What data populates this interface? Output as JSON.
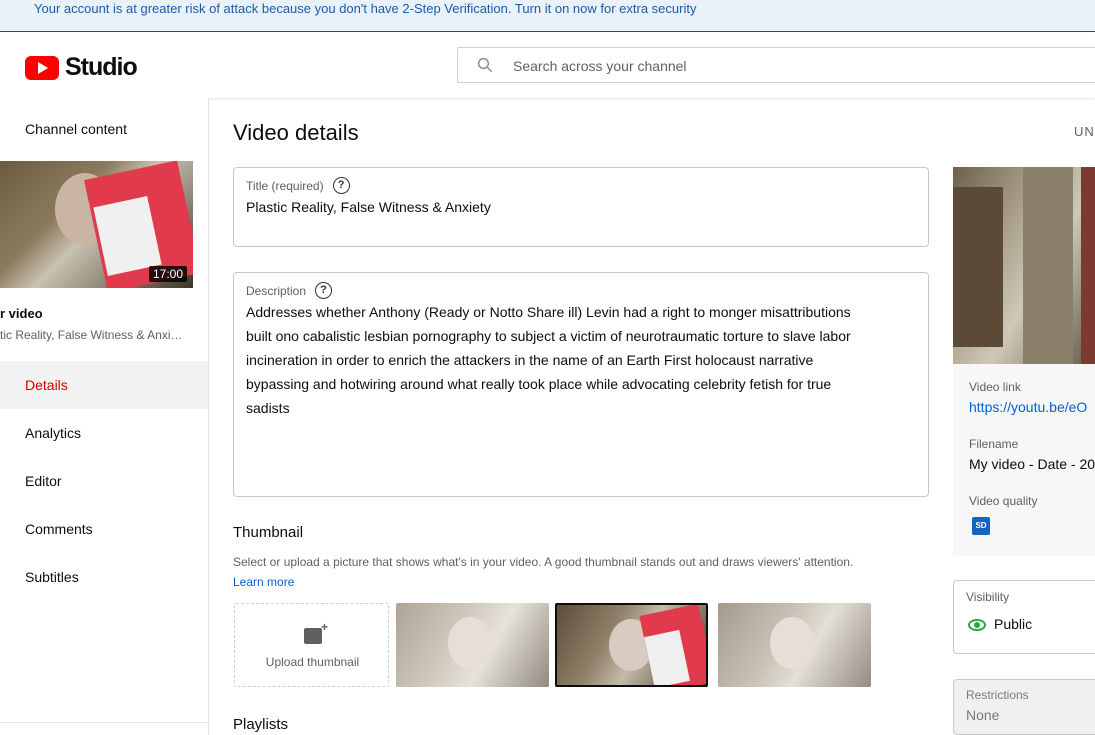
{
  "banner": {
    "text": "Your account is at greater risk of attack because you don't have 2-Step Verification. Turn it on now for extra security"
  },
  "header": {
    "logo_text": "Studio",
    "search_placeholder": "Search across your channel"
  },
  "sidebar": {
    "channel_content": "Channel content",
    "video_duration": "17:00",
    "your_video_label": "r video",
    "video_title": "tic Reality, False Witness & Anxi…",
    "nav": [
      {
        "label": "Details",
        "active": true
      },
      {
        "label": "Analytics"
      },
      {
        "label": "Editor"
      },
      {
        "label": "Comments"
      },
      {
        "label": "Subtitles"
      }
    ]
  },
  "main": {
    "page_title": "Video details",
    "undo_label": "UN",
    "title_field": {
      "label": "Title (required)",
      "value": "Plastic Reality, False Witness & Anxiety"
    },
    "description_field": {
      "label": "Description",
      "lines": [
        "Addresses whether Anthony (Ready or Notto Share ill) Levin had a right to monger misattributions",
        "built ono cabalistic lesbian pornography to subject a victim of neurotraumatic torture to slave labor",
        "incineration in order to enrich the attackers in the name of an Earth First holocaust narrative",
        "bypassing and hotwiring around what really took place while advocating celebrity fetish for true",
        "sadists"
      ]
    },
    "thumbnail": {
      "title": "Thumbnail",
      "description": "Select or upload a picture that shows what's in your video. A good thumbnail stands out and draws viewers' attention.",
      "learn_more": "Learn more",
      "upload_label": "Upload thumbnail",
      "selected_index": 1
    },
    "playlists_title": "Playlists"
  },
  "right_panel": {
    "video_link_label": "Video link",
    "video_link": "https://youtu.be/eO",
    "filename_label": "Filename",
    "filename": "My video - Date - 20",
    "quality_label": "Video quality",
    "quality_badge": "SD",
    "visibility_label": "Visibility",
    "visibility_value": "Public",
    "restrictions_label": "Restrictions",
    "restrictions_value": "None"
  },
  "colors": {
    "brand": "#ff0000",
    "link": "#065fd4",
    "active_nav": "#cc0000",
    "public_eye": "#2ba640",
    "banner_text": "#175da8"
  }
}
